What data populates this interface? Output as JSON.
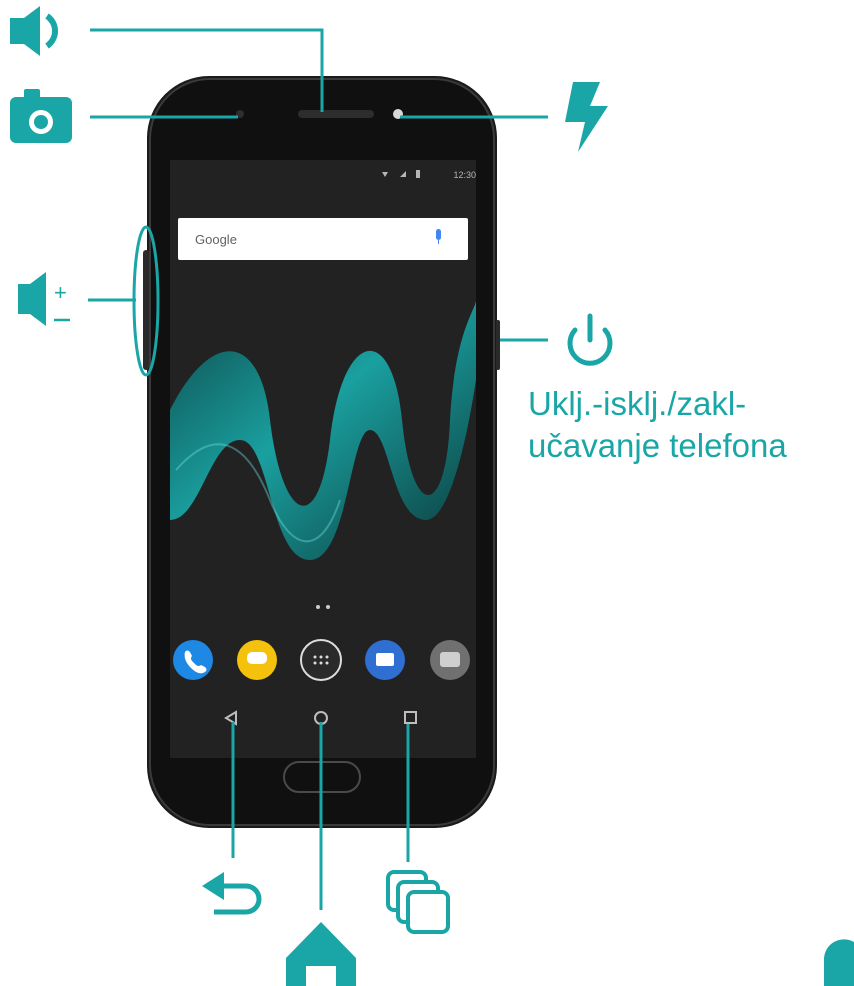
{
  "annotations": {
    "power_label": "Uklj.-isklj./zakl-\nučavanje telefona"
  },
  "phone": {
    "status_time": "12:30",
    "search_brand": "Google",
    "page_indicator": "• •"
  },
  "icons": {
    "speaker": "speaker-icon",
    "camera": "camera-icon",
    "flash": "flash-icon",
    "volume": "volume-plus-minus-icon",
    "power": "power-icon",
    "back": "back-arrow-icon",
    "home": "home-icon",
    "recent_apps": "recent-apps-icon"
  },
  "colors": {
    "accent": "#1aa6a6",
    "phone_body": "#141414",
    "screen": "#1e1e1e"
  }
}
